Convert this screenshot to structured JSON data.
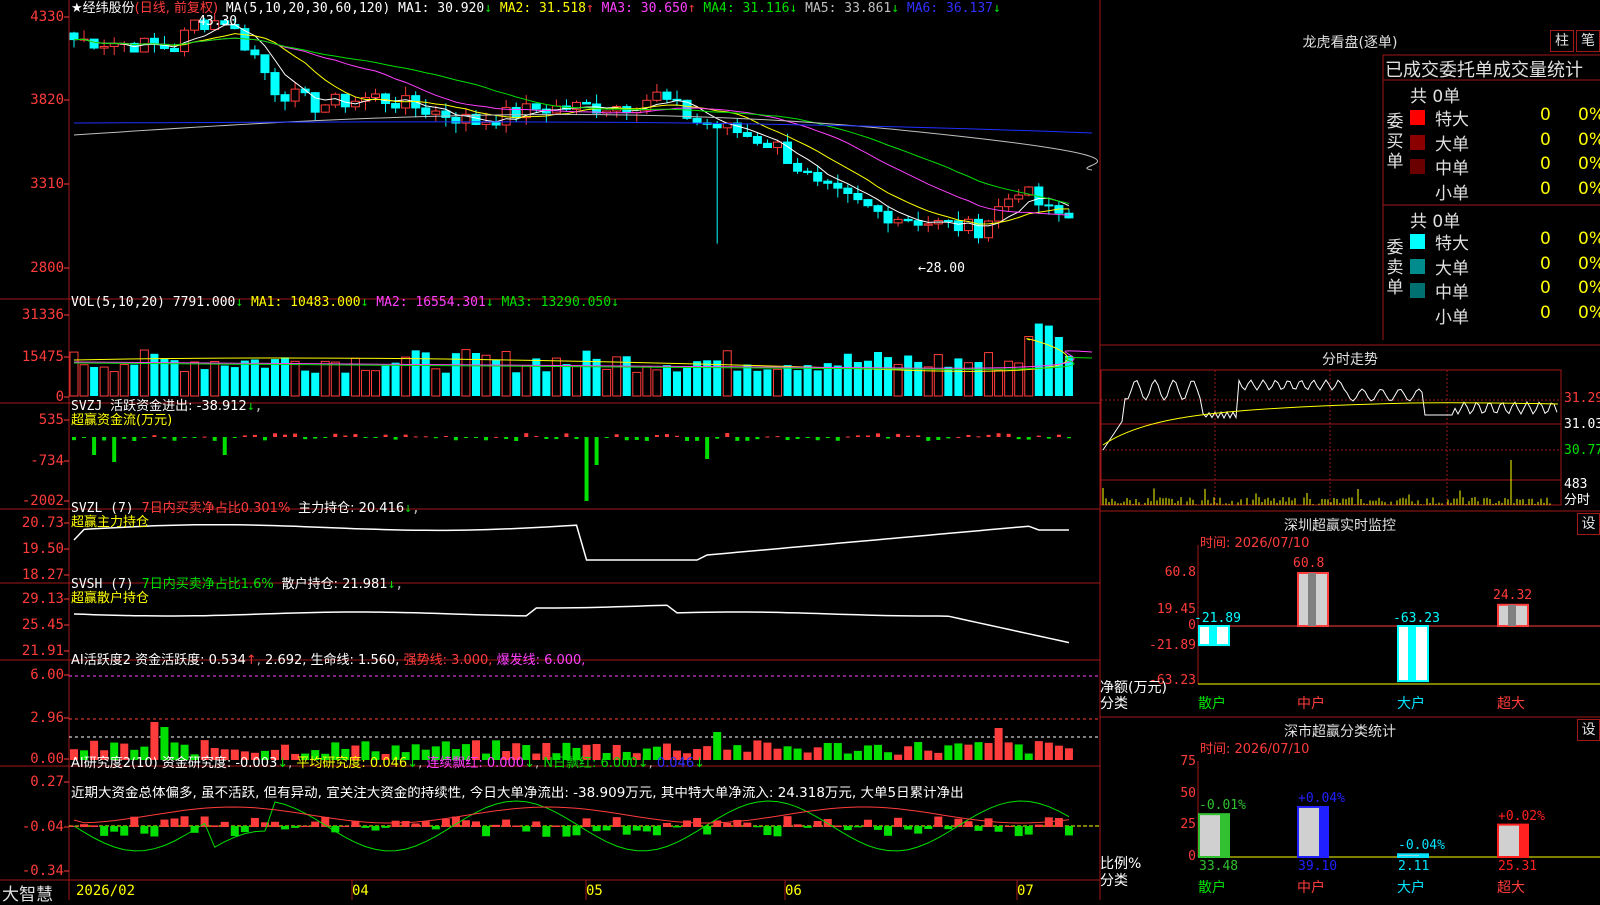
{
  "app": {
    "brand": "大智慧"
  },
  "kline": {
    "star": "★",
    "stock_name": "经纬股份",
    "period": "(日线, 前复权)",
    "ma_label": "MA(5,10,20,30,60,120)",
    "ma1": "MA1: 30.920",
    "ma2": "MA2: 31.518",
    "ma3": "MA3: 30.650",
    "ma4": "MA4: 31.116",
    "ma5": "MA5: 33.861",
    "ma6": "MA6: 36.137",
    "arrow_down": "↓",
    "arrow_up": "↑",
    "high_label": "43.30",
    "low_label": "←28.00",
    "yticks": [
      "4330",
      "3820",
      "3310",
      "2800"
    ]
  },
  "vol": {
    "label": "VOL(5,10,20)",
    "value": "7791.000",
    "ma1": "MA1: 10483.000",
    "ma2": "MA2: 16554.301",
    "ma3": "MA3: 13290.050",
    "yticks": [
      "31336",
      "15475",
      "0"
    ]
  },
  "svzj": {
    "label": "SVZJ",
    "text": "活跃资金进出: -38.912",
    "sub": "超赢资金流(万元)",
    "yticks": [
      "535",
      "-734",
      "-2002"
    ]
  },
  "svzl": {
    "label": "SVZL (7)",
    "ratio": "7日内买卖净占比0.301%",
    "hold": "主力持仓: 20.416",
    "sub": "超赢主力持仓",
    "yticks": [
      "20.73",
      "19.50",
      "18.27"
    ]
  },
  "svsh": {
    "label": "SVSH (7)",
    "ratio": "7日内买卖净占比1.6%",
    "hold": "散户持仓: 21.981",
    "sub": "超赢散户持仓",
    "yticks": [
      "29.13",
      "25.45",
      "21.91"
    ]
  },
  "ai_active": {
    "label": "AI活跃度2",
    "a": "资金活跃度: 0.534",
    "b": "2.692,",
    "c": "生命线: 1.560,",
    "d": "强势线: 3.000,",
    "e": "爆发线: 6.000,",
    "yticks": [
      "6.00",
      "2.96",
      "0.00"
    ]
  },
  "ai_research": {
    "label": "AI研究度2(10)",
    "a": "资金研究度: -0.003",
    "b": "平均研究度: 0.046",
    "c": "连续飘红: 0.000",
    "d": "N日飘红: 6.000",
    "e": "0.046",
    "comment": "近期大资金总体偏多, 虽不活跃, 但有异动, 宜关注大资金的持续性, 今日大单净流出: -38.909万元, 其中特大单净流入: 24.318万元, 大单5日累计净出",
    "yticks": [
      "0.27",
      "-0.04",
      "-0.34"
    ]
  },
  "xaxis": [
    "2026/02",
    "04",
    "05",
    "06",
    "07"
  ],
  "dragon": {
    "title": "龙虎看盘(逐单)",
    "btn1": "柱",
    "btn2": "笔",
    "header": "已成交委托单成交量统计",
    "buy_label": "委买单",
    "sell_label": "委卖单",
    "buy_total": "共 0单",
    "sell_total": "共 0单",
    "rows": [
      "特大",
      "大单",
      "中单",
      "小单"
    ],
    "buy_colors": [
      "#ff0000",
      "#8a0000",
      "#6a0000",
      "#000000"
    ],
    "sell_colors": [
      "#00ffff",
      "#008c8c",
      "#007070",
      "#000000"
    ],
    "count": "0",
    "pct": "0%"
  },
  "fenshi": {
    "title": "分时走势",
    "yticks": [
      "31.29",
      "31.03",
      "30.77"
    ],
    "vol_tick": "483",
    "unit": "分时"
  },
  "monitor": {
    "title": "深圳超赢实时监控",
    "btn": "设",
    "time": "时间: 2026/07/10",
    "yticks": [
      "60.8",
      "19.45",
      "0",
      "-21.89",
      "-63.23"
    ],
    "ylabel": "净额(万元)",
    "xlabel": "分类",
    "categories": [
      "散户",
      "中户",
      "大户",
      "超大"
    ],
    "values": [
      -21.89,
      60.8,
      -63.23,
      24.32
    ],
    "value_labels": [
      "-21.89",
      "60.8",
      "-63.23",
      "24.32"
    ]
  },
  "classify": {
    "title": "深市超赢分类统计",
    "btn": "设",
    "time": "时间: 2026/07/10",
    "yticks": [
      "75",
      "50",
      "25",
      "0"
    ],
    "ylabel": "比例%",
    "xlabel": "分类",
    "categories": [
      "散户",
      "中户",
      "大户",
      "超大"
    ],
    "values": [
      33.48,
      39.1,
      2.11,
      25.31
    ],
    "value_labels": [
      "33.48",
      "39.10",
      "2.11",
      "25.31"
    ],
    "change_labels": [
      "-0.01%",
      "+0.04%",
      "-0.04%",
      "+0.02%"
    ],
    "colors": [
      "#30c030",
      "#2020ff",
      "#00e5ff",
      "#ff2020"
    ]
  },
  "chart_data": {
    "type": "bar",
    "title": "深圳超赢实时监控",
    "categories": [
      "散户",
      "中户",
      "大户",
      "超大"
    ],
    "series": [
      {
        "name": "净额(万元)",
        "values": [
          -21.89,
          60.8,
          -63.23,
          24.32
        ]
      },
      {
        "name": "比例%",
        "values": [
          33.48,
          39.1,
          2.11,
          25.31
        ]
      }
    ],
    "ylabel": "净额(万元)"
  }
}
